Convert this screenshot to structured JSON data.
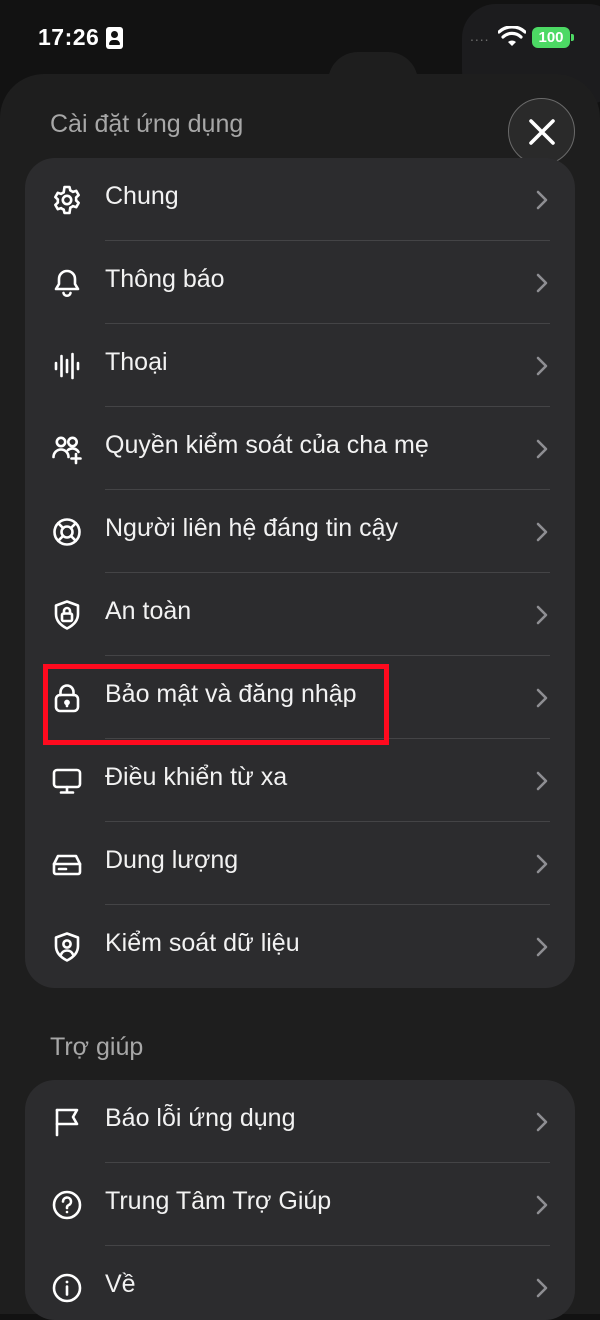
{
  "status_bar": {
    "time": "17:26",
    "cellular": "....",
    "battery": "100",
    "battery_color": "#4cd964"
  },
  "app_settings": {
    "title": "Cài đặt ứng dụng",
    "items": [
      {
        "label": "Chung",
        "icon": "gear-icon"
      },
      {
        "label": "Thông báo",
        "icon": "bell-icon"
      },
      {
        "label": "Thoại",
        "icon": "waveform-icon"
      },
      {
        "label": "Quyền kiểm soát của cha mẹ",
        "icon": "family-add-icon"
      },
      {
        "label": "Người liên hệ đáng tin cậy",
        "icon": "lifebuoy-icon"
      },
      {
        "label": "An toàn",
        "icon": "shield-lock-icon"
      },
      {
        "label": "Bảo mật và đăng nhập",
        "icon": "lock-icon"
      },
      {
        "label": "Điều khiển từ xa",
        "icon": "monitor-icon"
      },
      {
        "label": "Dung lượng",
        "icon": "storage-icon"
      },
      {
        "label": "Kiểm soát dữ liệu",
        "icon": "shield-user-icon"
      }
    ]
  },
  "help": {
    "title": "Trợ giúp",
    "items": [
      {
        "label": "Báo lỗi ứng dụng",
        "icon": "flag-icon"
      },
      {
        "label": "Trung Tâm Trợ Giúp",
        "icon": "question-circle-icon"
      },
      {
        "label": "Về",
        "icon": "info-circle-icon"
      }
    ]
  },
  "highlight_color": "#ff0a1e"
}
